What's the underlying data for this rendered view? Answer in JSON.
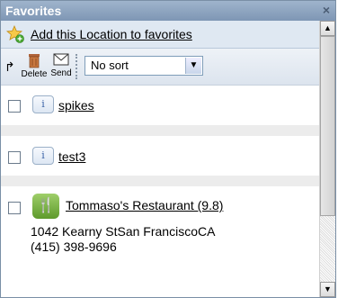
{
  "panel": {
    "title": "Favorites",
    "close_icon": "×"
  },
  "add_bar": {
    "link_label": "Add this Location to favorites",
    "icon": "star-add-icon"
  },
  "toolbar": {
    "delete_label": "Delete",
    "send_label": "Send",
    "sort": {
      "selected": "No sort"
    }
  },
  "favorites": [
    {
      "name": "spikes",
      "icon": "info-icon"
    },
    {
      "name": "test3",
      "icon": "info-icon"
    },
    {
      "name": "Tommaso's Restaurant (9.8)",
      "icon": "restaurant-icon",
      "address": "1042 Kearny StSan FranciscoCA",
      "phone": "(415) 398-9696"
    }
  ]
}
